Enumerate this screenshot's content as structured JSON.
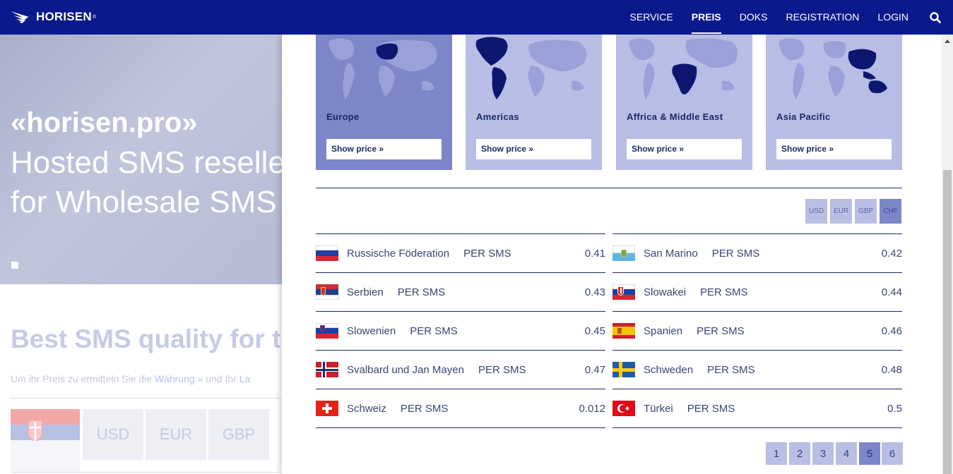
{
  "navbar": {
    "brand": "HORISEN",
    "trademark": "®",
    "items": [
      {
        "label": "SERVICE",
        "active": false
      },
      {
        "label": "PREIS",
        "active": true
      },
      {
        "label": "DOKS",
        "active": false
      },
      {
        "label": "REGISTRATION",
        "active": false
      },
      {
        "label": "LOGIN",
        "active": false
      }
    ],
    "search_icon": "search-icon"
  },
  "background": {
    "hero_title": "«horisen.pro»",
    "hero_line1": "Hosted SMS reselle",
    "hero_line2": "for Wholesale SMS",
    "heading": "Best SMS quality for th",
    "intro_before": "Um ihr Preis zu ermitteln Sie die ",
    "intro_link1": "Währung »",
    "intro_middle": "  und Ihr ",
    "intro_link2": "La",
    "currencies": [
      "USD",
      "EUR",
      "GBP"
    ]
  },
  "regions": [
    {
      "name": "Europe",
      "button": "Show price »",
      "active": true
    },
    {
      "name": "Americas",
      "button": "Show price »",
      "active": false
    },
    {
      "name": "Affrica & Middle East",
      "button": "Show price »",
      "active": false
    },
    {
      "name": "Asia Pacific",
      "button": "Show price »",
      "active": false
    }
  ],
  "currency_options": [
    "USD",
    "EUR",
    "GBP",
    "CHF"
  ],
  "selected_currency": "CHF",
  "prices_left": [
    {
      "country": "Russische Föderation",
      "unit": "PER SMS",
      "price": "0.41",
      "flag": "russia-flag-icon"
    },
    {
      "country": "Serbien",
      "unit": "PER SMS",
      "price": "0.43",
      "flag": "serbia-flag-icon"
    },
    {
      "country": "Slowenien",
      "unit": "PER SMS",
      "price": "0.45",
      "flag": "slovenia-flag-icon"
    },
    {
      "country": "Svalbard und Jan Mayen",
      "unit": "PER SMS",
      "price": "0.47",
      "flag": "norway-flag-icon"
    },
    {
      "country": "Schweiz",
      "unit": "PER SMS",
      "price": "0.012",
      "flag": "switzerland-flag-icon"
    }
  ],
  "prices_right": [
    {
      "country": "San Marino",
      "unit": "PER SMS",
      "price": "0.42",
      "flag": "san-marino-flag-icon"
    },
    {
      "country": "Slowakei",
      "unit": "PER SMS",
      "price": "0.44",
      "flag": "slovakia-flag-icon"
    },
    {
      "country": "Spanien",
      "unit": "PER SMS",
      "price": "0.46",
      "flag": "spain-flag-icon"
    },
    {
      "country": "Schweden",
      "unit": "PER SMS",
      "price": "0.48",
      "flag": "sweden-flag-icon"
    },
    {
      "country": "Türkei",
      "unit": "PER SMS",
      "price": "0.5",
      "flag": "turkey-flag-icon"
    }
  ],
  "pagination": {
    "pages": [
      "1",
      "2",
      "3",
      "4",
      "5",
      "6"
    ],
    "current": "5"
  },
  "colors": {
    "nav": "#0a1a8c",
    "card": "#b8bde6",
    "card_active": "#7c86c8",
    "text": "#1c2a5e"
  }
}
